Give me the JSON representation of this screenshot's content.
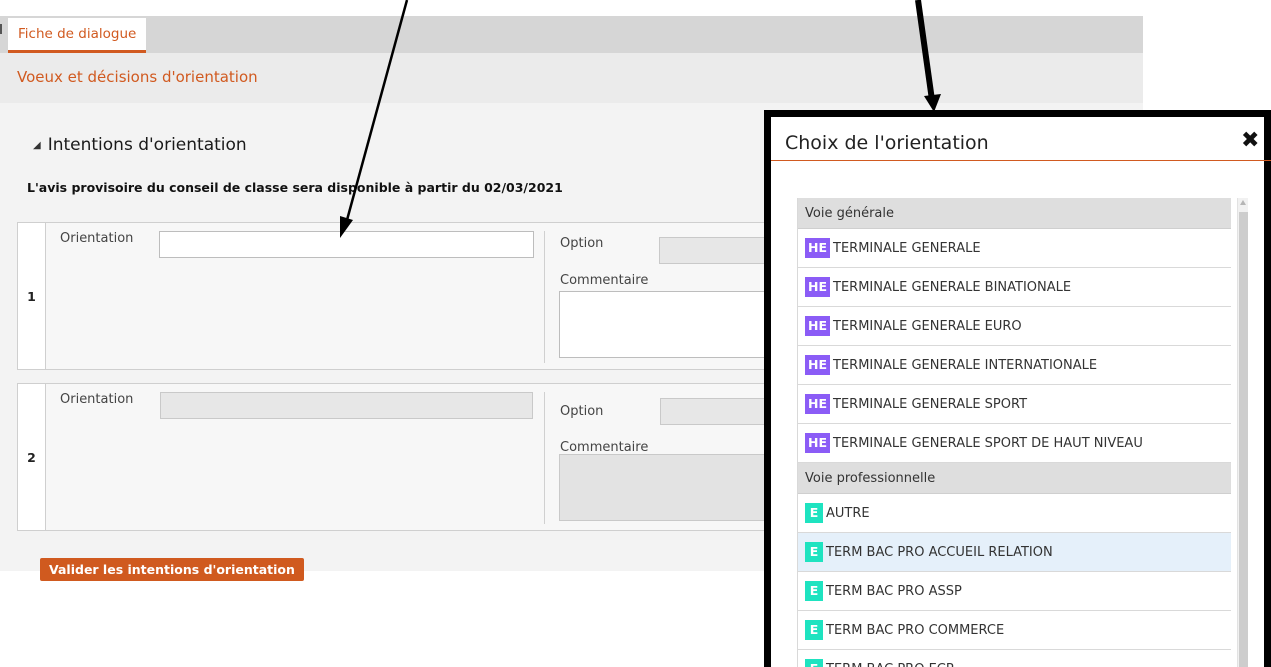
{
  "tabs": {
    "active_label": "Fiche de dialogue"
  },
  "subheader": {
    "title": "Voeux et décisions d'orientation"
  },
  "section": {
    "title": "Intentions d'orientation",
    "notice": "L'avis provisoire du conseil de classe sera disponible à partir du 02/03/2021"
  },
  "rows": [
    {
      "number": "1",
      "orientation_label": "Orientation",
      "option_label": "Option",
      "comment_label": "Commentaire"
    },
    {
      "number": "2",
      "orientation_label": "Orientation",
      "option_label": "Option",
      "comment_label": "Commentaire"
    }
  ],
  "validate_button": "Valider les intentions d'orientation",
  "modal": {
    "title": "Choix de l'orientation",
    "close_icon": "close-icon",
    "groups": [
      {
        "label": "Voie générale",
        "items": [
          {
            "badge": "HE",
            "label": "TERMINALE GENERALE"
          },
          {
            "badge": "HE",
            "label": "TERMINALE GENERALE BINATIONALE"
          },
          {
            "badge": "HE",
            "label": "TERMINALE GENERALE EURO"
          },
          {
            "badge": "HE",
            "label": "TERMINALE GENERALE INTERNATIONALE"
          },
          {
            "badge": "HE",
            "label": "TERMINALE GENERALE SPORT"
          },
          {
            "badge": "HE",
            "label": "TERMINALE GENERALE SPORT DE HAUT NIVEAU"
          }
        ]
      },
      {
        "label": "Voie professionnelle",
        "items": [
          {
            "badge": "E",
            "label": "AUTRE"
          },
          {
            "badge": "E",
            "label": "TERM BAC PRO ACCUEIL RELATION"
          },
          {
            "badge": "E",
            "label": "TERM BAC PRO ASSP"
          },
          {
            "badge": "E",
            "label": "TERM BAC PRO COMMERCE"
          },
          {
            "badge": "E",
            "label": "TERM BAC PRO ECP"
          }
        ]
      }
    ]
  },
  "colors": {
    "accent": "#d15a20",
    "badge_he": "#8b5cf6",
    "badge_e": "#1ee3c0",
    "highlight_row": "#e5f0fa"
  }
}
